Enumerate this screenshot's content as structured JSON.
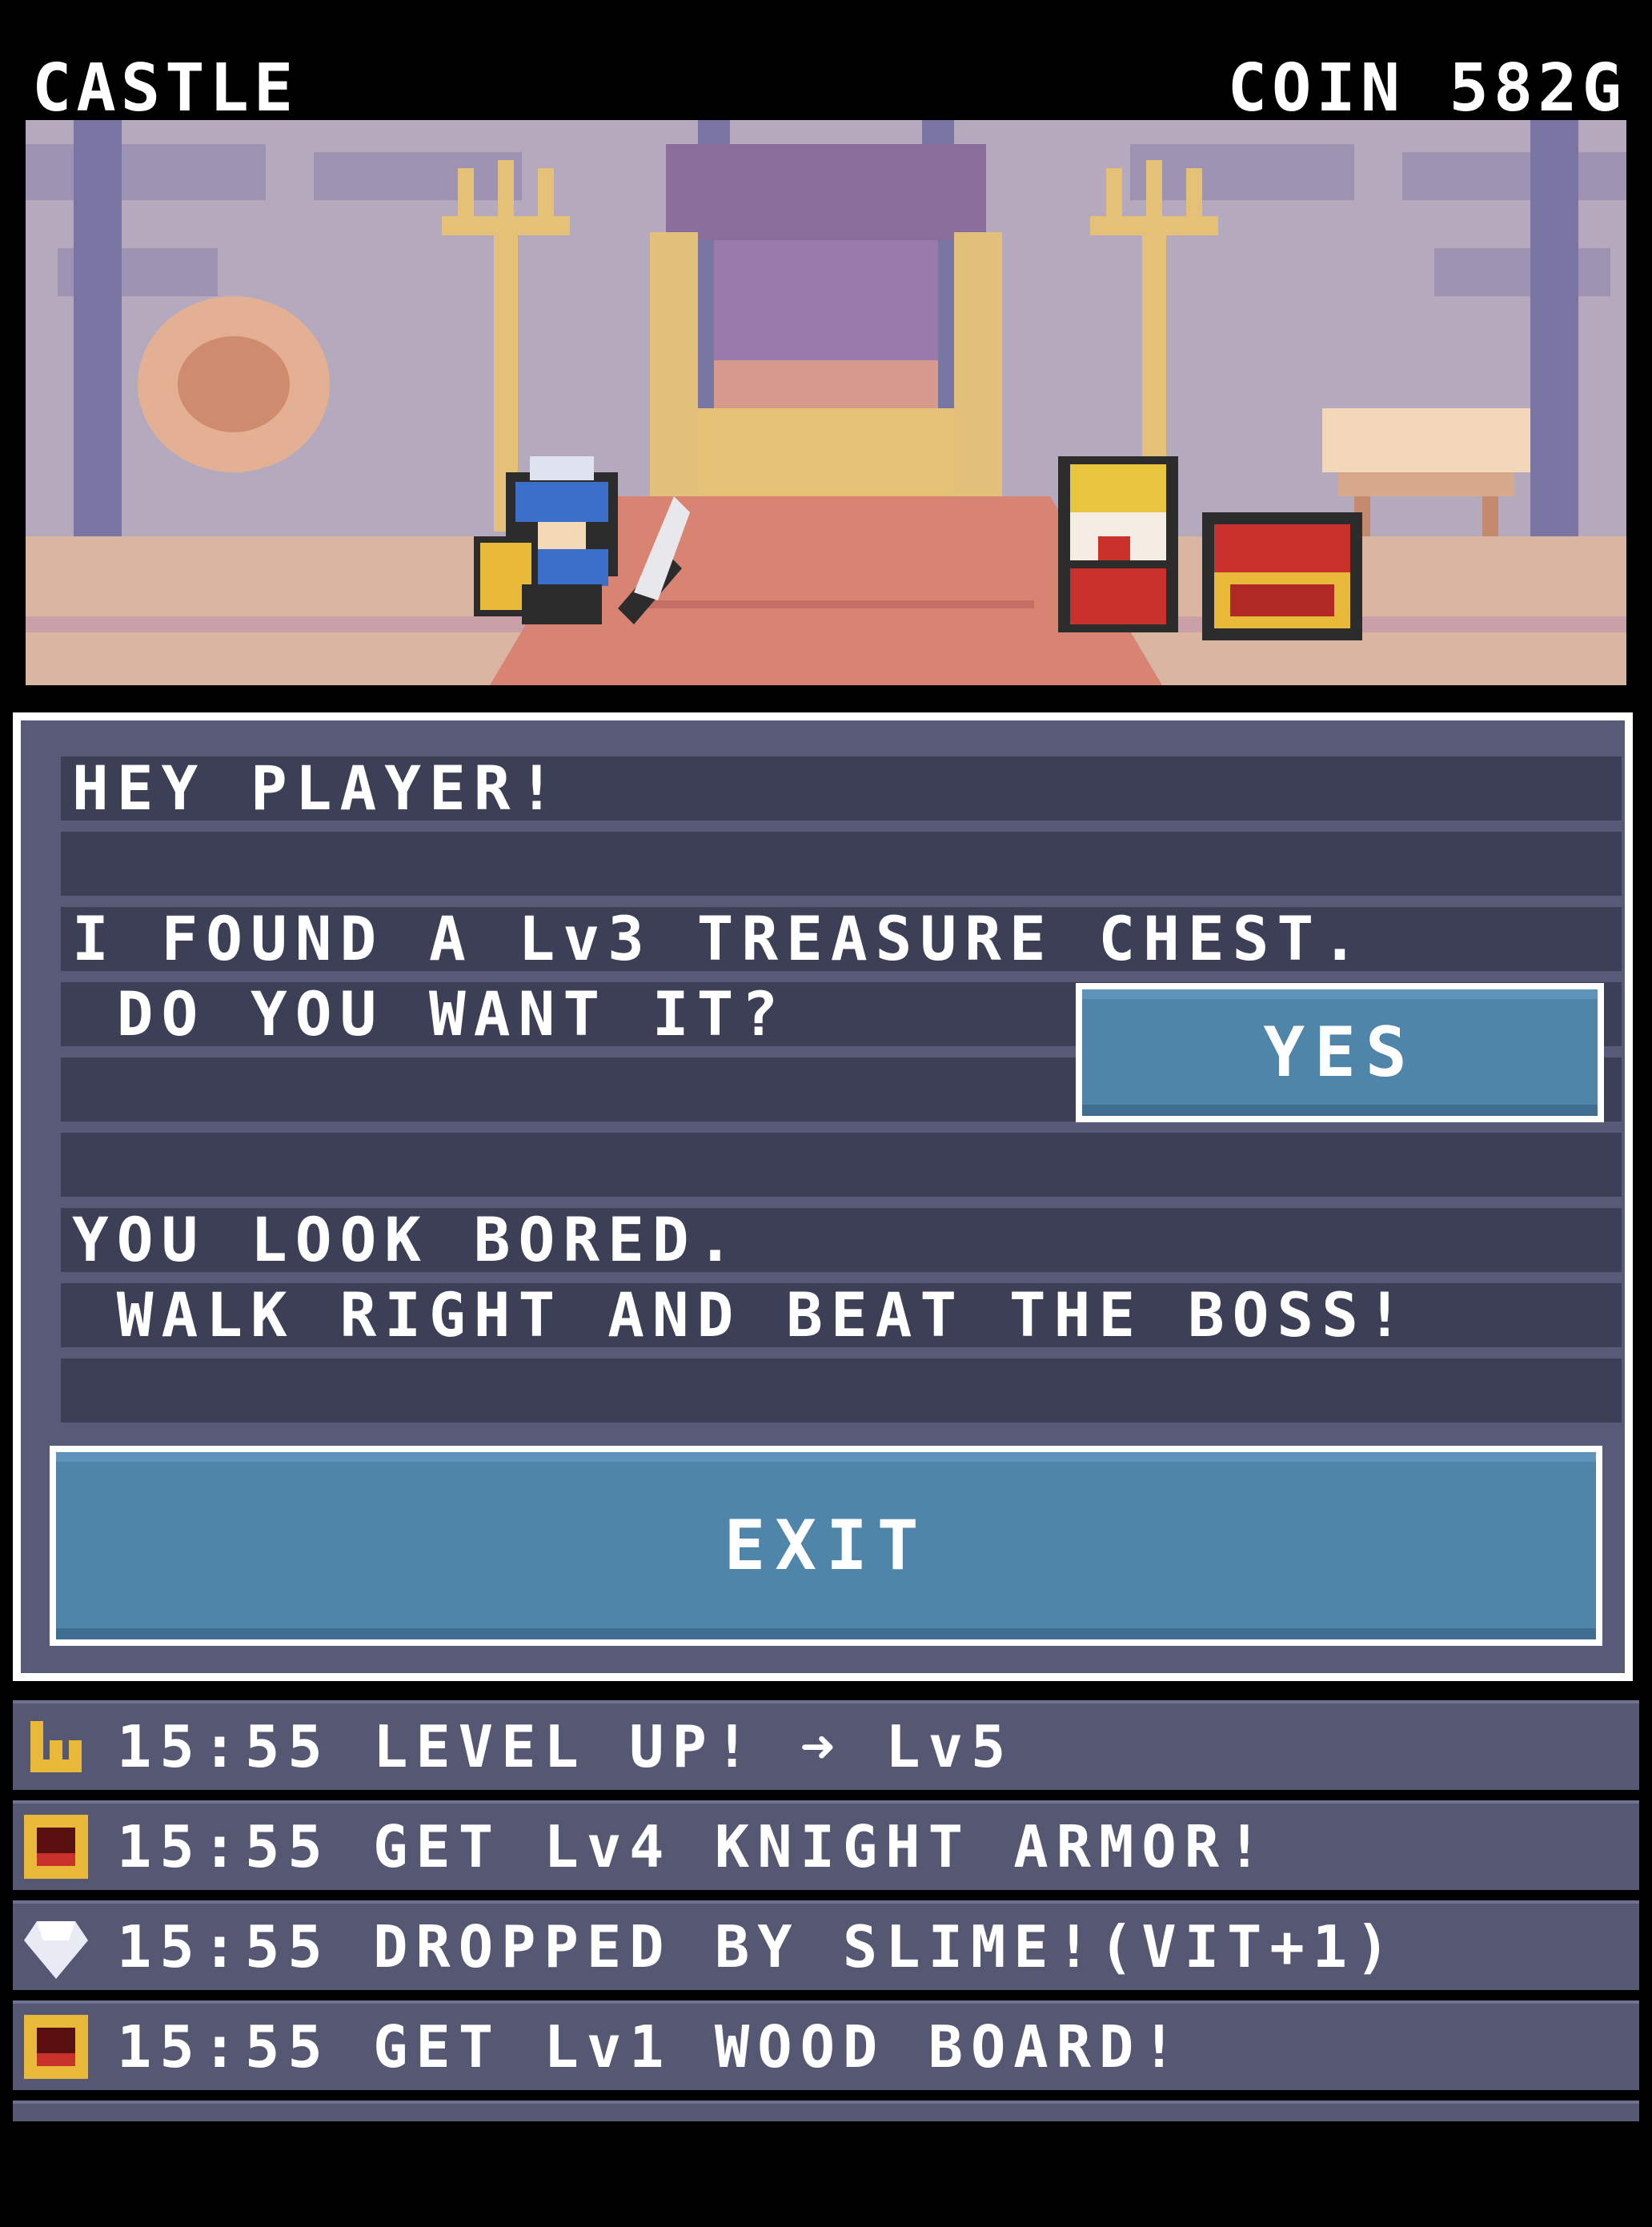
{
  "hud": {
    "location": "CASTLE",
    "coin": "COIN 582G"
  },
  "dialog": {
    "lines": [
      "HEY PLAYER!",
      "",
      "I FOUND A Lv3 TREASURE CHEST.",
      " DO YOU WANT IT?",
      "",
      "",
      "YOU LOOK BORED.",
      " WALK RIGHT AND BEAT THE BOSS!",
      ""
    ],
    "yes_label": "YES",
    "exit_label": "EXIT"
  },
  "log": [
    {
      "icon": "level-up-icon",
      "text": "15:55 LEVEL UP! ➜ Lv5"
    },
    {
      "icon": "treasure-chest-icon",
      "text": "15:55 GET Lv4 KNIGHT ARMOR!"
    },
    {
      "icon": "gem-icon",
      "text": "15:55 DROPPED BY SLIME!(VIT+1)"
    },
    {
      "icon": "treasure-chest-icon",
      "text": "15:55 GET Lv1 WOOD BOARD!"
    }
  ],
  "colors": {
    "button": "#4f85a9",
    "panel": "#585a78",
    "line": "#3d3f57",
    "log": "#565873"
  }
}
